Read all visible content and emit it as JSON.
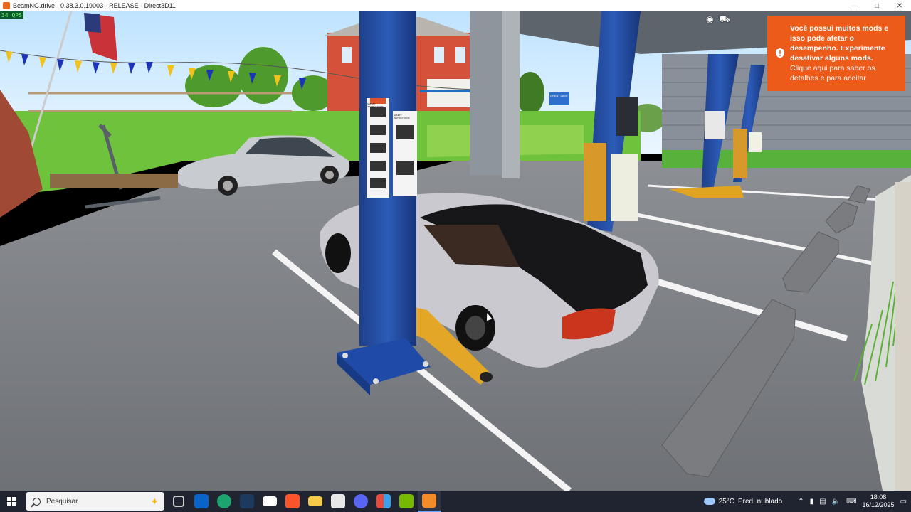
{
  "window": {
    "title": "BeamNG.drive - 0.38.3.0.19003 - RELEASE - Direct3D11",
    "icon": "beamng-app-icon",
    "controls": [
      "minimize",
      "maximize",
      "close"
    ]
  },
  "hud": {
    "fps": "34 QPS",
    "icons": [
      "eye-icon",
      "vehicle-icon"
    ]
  },
  "notification": {
    "line1": "Você possui muitos mods e isso pode afetar o desempenho. Experimente desativar alguns mods.",
    "line2": "Clique aqui para saber os detalhes e para aceitar",
    "icon": "shield-alert-icon",
    "color": "#ec5b1a"
  },
  "scene": {
    "signs": {
      "sign1": "SAFETY INSTRUCTIONS",
      "sign2": "SAFETY INSTRUCTIONS",
      "banner": "GREAT LAKE"
    }
  },
  "taskbar": {
    "search_placeholder": "Pesquisar",
    "apps": [
      "task-view",
      "outlook",
      "edge",
      "steam",
      "file-explorer",
      "brave",
      "files",
      "microsoft-store",
      "discord",
      "app-grid",
      "nvidia",
      "beamng"
    ],
    "weather": {
      "temp": "25°C",
      "condition": "Pred. nublado"
    },
    "time": "18:08",
    "date": "16/12/2025"
  }
}
